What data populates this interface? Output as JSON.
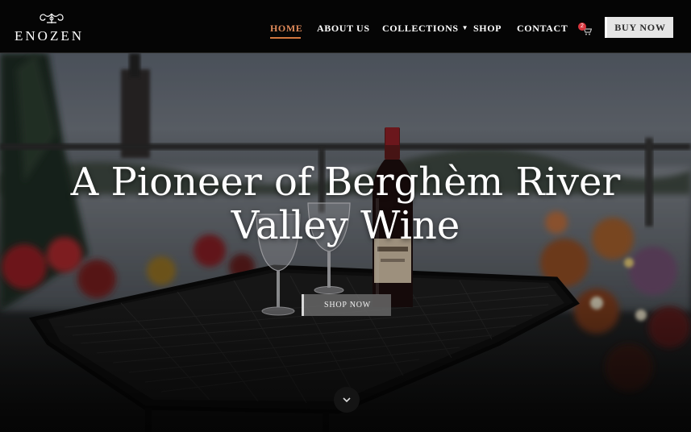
{
  "brand": {
    "name": "ENOZEN",
    "logo_icon": "ornament-icon"
  },
  "nav": {
    "items": [
      {
        "label": "HOME",
        "active": true
      },
      {
        "label": "ABOUT US"
      },
      {
        "label": "COLLECTIONS"
      },
      {
        "label": "SHOP"
      },
      {
        "label": "CONTACT"
      }
    ]
  },
  "cart": {
    "count": "2",
    "icon": "cart-icon"
  },
  "buy_button": "BUY NOW",
  "hero": {
    "title_line1": "A Pioneer of Berghèm River",
    "title_line2": "Valley Wine",
    "cta": "SHOP NOW",
    "scroll_icon": "chevron-down-icon"
  },
  "colors": {
    "accent": "#d2773f",
    "header_bg": "#050505",
    "button_bg": "#e5e5e5"
  }
}
